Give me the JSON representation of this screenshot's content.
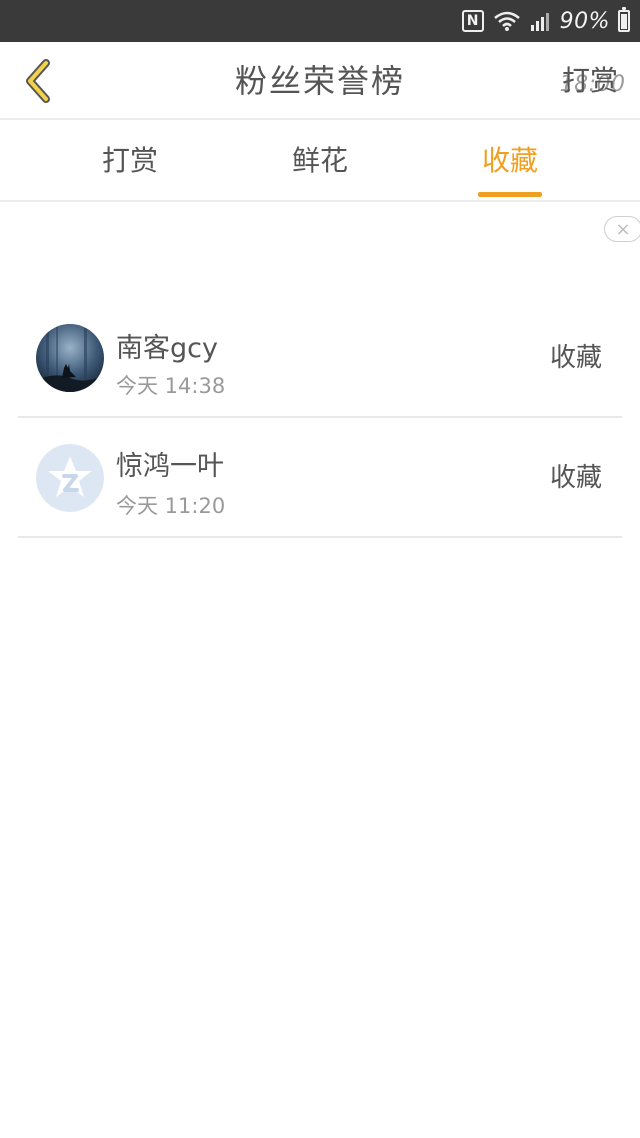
{
  "status_bar": {
    "nfc_label": "N",
    "battery_text": "90%",
    "time": "18:00",
    "icons": [
      "nfc-icon",
      "wifi-icon",
      "signal-icon",
      "battery-icon"
    ]
  },
  "header": {
    "title": "粉丝荣誉榜",
    "right_link": "打赏",
    "back_icon": "chevron-left-icon"
  },
  "tabs": [
    {
      "label": "打赏",
      "active": false
    },
    {
      "label": "鲜花",
      "active": false
    },
    {
      "label": "收藏",
      "active": true
    }
  ],
  "colors": {
    "accent": "#f0a020",
    "status_bar_bg": "#3a3a3a",
    "text": "#555555",
    "subtext": "#9a9a9a"
  },
  "close_label": "×",
  "list": [
    {
      "name": "南客gcy",
      "time": "今天 14:38",
      "action": "收藏",
      "avatar": "wolf-avatar"
    },
    {
      "name": "惊鸿一叶",
      "time": "今天 11:20",
      "action": "收藏",
      "avatar": "default-avatar"
    }
  ]
}
